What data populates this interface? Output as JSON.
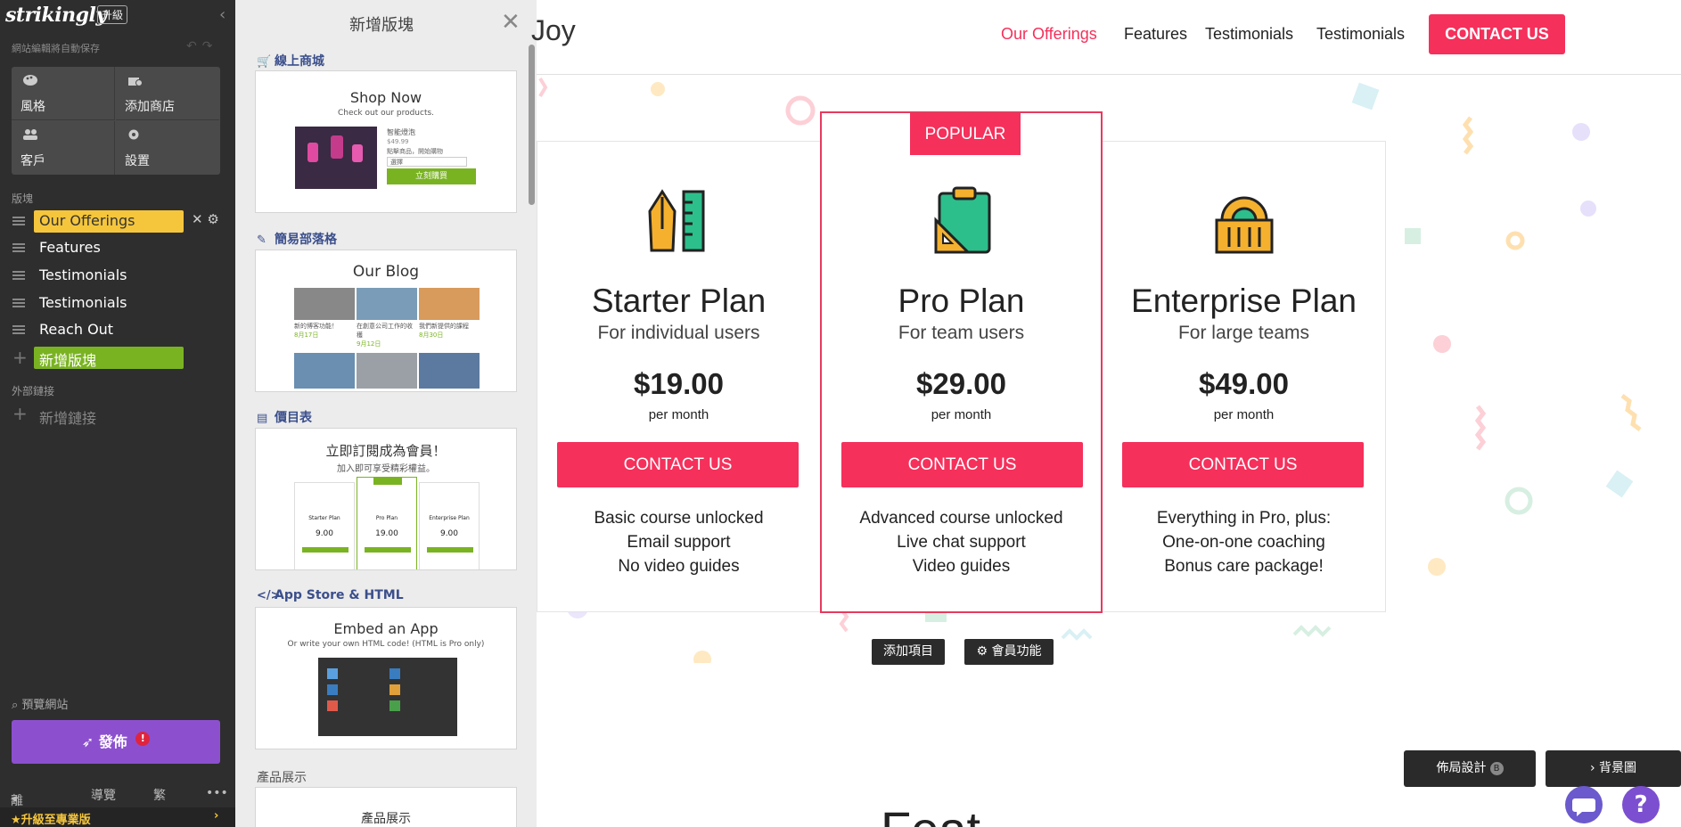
{
  "sidebar": {
    "logo": "strikingly",
    "upgrade_tag": "升級",
    "autosave": "網站編輯將自動保存",
    "quick": [
      {
        "label": "風格",
        "icon": "palette-icon"
      },
      {
        "label": "添加商店",
        "icon": "store-icon"
      },
      {
        "label": "客戶",
        "icon": "users-icon"
      },
      {
        "label": "設置",
        "icon": "gear-icon"
      }
    ],
    "blocks_title": "版塊",
    "blocks": [
      "Our Offerings",
      "Features",
      "Testimonials",
      "Testimonials",
      "Reach Out"
    ],
    "add_block": "新增版塊",
    "external_title": "外部鏈接",
    "add_link": "新增鏈接",
    "preview": "預覽網站",
    "publish": "發佈",
    "publish_alert": "!",
    "footer": {
      "exit": "離開",
      "nav": "導覽",
      "lang": "繁",
      "more": "•••"
    },
    "promo": "升級至專業版"
  },
  "panel": {
    "title": "新增版塊",
    "categories": [
      {
        "label": "線上商城",
        "card_title": "Shop Now",
        "card_sub": "Check out our products.",
        "product_name": "智能燈泡",
        "product_price": "$49.99",
        "product_note": "點擊商品，開始購物",
        "qty_label": "選擇",
        "buy_label": "立刻購買"
      },
      {
        "label": "簡易部落格",
        "card_title": "Our Blog",
        "posts": [
          {
            "title": "新的博客功能！",
            "date": "8月17日"
          },
          {
            "title": "在創意公司工作的收穫",
            "date": "9月12日"
          },
          {
            "title": "我們新提供的課程",
            "date": "8月30日"
          }
        ]
      },
      {
        "label": "價目表",
        "card_title": "立即訂閱成為會員！",
        "card_sub": "加入即可享受精彩權益。",
        "mini_plans": [
          {
            "name": "Starter Plan",
            "price": "9.00"
          },
          {
            "name": "Pro Plan",
            "price": "19.00"
          },
          {
            "name": "Enterprise Plan",
            "price": "9.00"
          }
        ]
      },
      {
        "label": "App Store & HTML",
        "card_title": "Embed an App",
        "card_sub": "Or write your own HTML code! (HTML is Pro only)"
      },
      {
        "label": "產品展示",
        "card_title": "產品展示"
      }
    ]
  },
  "site": {
    "brand": "Joy",
    "nav": [
      "Our Offerings",
      "Features",
      "Testimonials",
      "Testimonials"
    ],
    "nav_cta": "CONTACT US",
    "plans": [
      {
        "name": "Starter Plan",
        "for": "For individual users",
        "price": "$19.00",
        "per": "per month",
        "cta": "CONTACT US",
        "features": [
          "Basic course unlocked",
          "Email support",
          "No video guides"
        ],
        "icon": "pen-ruler-icon"
      },
      {
        "name": "Pro Plan",
        "for": "For team users",
        "price": "$29.00",
        "per": "per month",
        "cta": "CONTACT US",
        "features": [
          "Advanced course unlocked",
          "Live chat support",
          "Video guides"
        ],
        "icon": "clipboard-icon",
        "badge": "POPULAR"
      },
      {
        "name": "Enterprise Plan",
        "for": "For large teams",
        "price": "$49.00",
        "per": "per month",
        "cta": "CONTACT US",
        "features": [
          "Everything in Pro, plus:",
          "One-on-one coaching",
          "Bonus care package!"
        ],
        "icon": "building-icon"
      }
    ],
    "add_item": "添加項目",
    "member_feature": "會員功能",
    "layout_btn": "佈局設計",
    "layout_key": "B",
    "background_btn": "背景圖",
    "next_heading": "Feat"
  },
  "colors": {
    "accent": "#f5305b",
    "sidebar_bg": "#2e2e2e",
    "active_block": "#f5c63c",
    "add_block": "#7ab322",
    "publish": "#8c50cf"
  }
}
